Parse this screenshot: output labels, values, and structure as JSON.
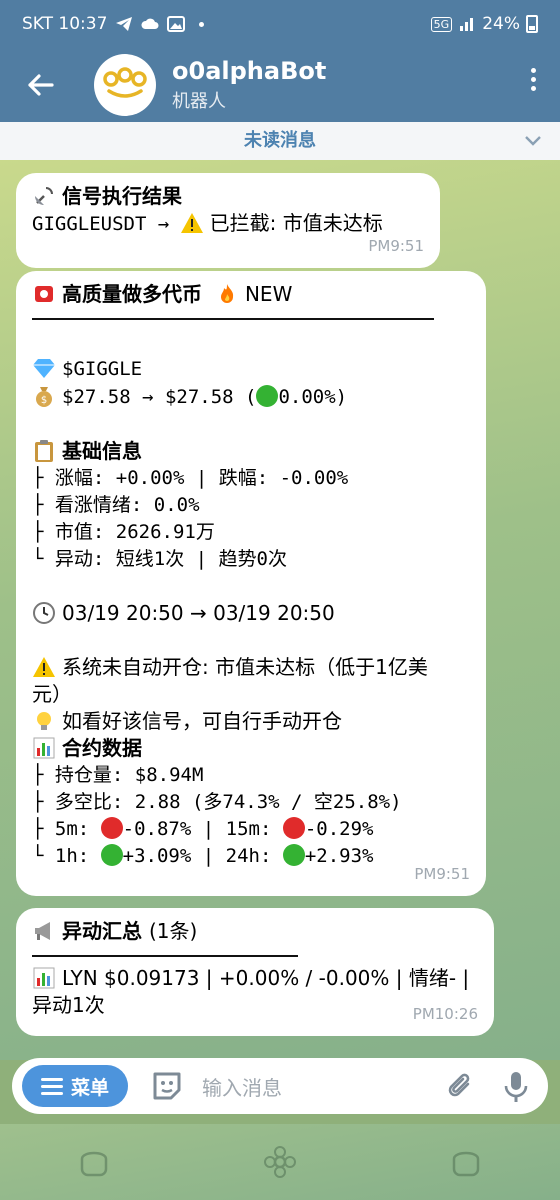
{
  "status_bar": {
    "carrier_time": "SKT 10:37",
    "net": "5G",
    "battery": "24%"
  },
  "header": {
    "title": "o0alphaBot",
    "subtitle": "机器人",
    "avatar_text": "o0o"
  },
  "unread_banner": "未读消息",
  "messages": [
    {
      "lines": [
        "信号执行结果",
        "GIGGLEUSDT →",
        "已拦截: 市值未达标"
      ],
      "time": "PM9:51"
    },
    {
      "title": "高质量做多代币",
      "title_tag": "NEW",
      "ticker": "$GIGGLE",
      "price": "$27.58 → $27.58 (",
      "price_change": "0.00%)",
      "basic_title": "基础信息",
      "basic": [
        "├ 涨幅: +0.00% | 跌幅: -0.00%",
        "├ 看涨情绪: 0.0%",
        "├ 市值: 2626.91万",
        "└ 异动: 短线1次 | 趋势0次"
      ],
      "time_range": "03/19 20:50 → 03/19 20:50",
      "warning_line1": "系统未自动开仓: 市值未达标（低于1亿美",
      "warning_line2": "元）",
      "tip": "如看好该信号，可自行手动开仓",
      "contract_title": "合约数据",
      "contract_oi": "├ 持仓量: $8.94M",
      "contract_ls": "├ 多空比: 2.88 (多74.3% / 空25.8%)",
      "c5m_label": "├ 5m:",
      "c5m_value": "-0.87%",
      "c15m_label": "| 15m:",
      "c15m_value": "-0.29%",
      "c1h_label": "└ 1h:",
      "c1h_value": "+3.09%",
      "c24h_label": "| 24h:",
      "c24h_value": "+2.93%",
      "time": "PM9:51"
    },
    {
      "title": "异动汇总",
      "count": "(1条)",
      "line1": "LYN $0.09173 | +0.00% / -0.00% | 情绪- |",
      "line2": "异动1次",
      "time": "PM10:26"
    }
  ],
  "input": {
    "menu_label": "菜单",
    "placeholder": "输入消息"
  },
  "colors": {
    "header": "#517da2",
    "accent": "#4d94dc",
    "green": "#34b233",
    "red": "#e02b2b"
  }
}
